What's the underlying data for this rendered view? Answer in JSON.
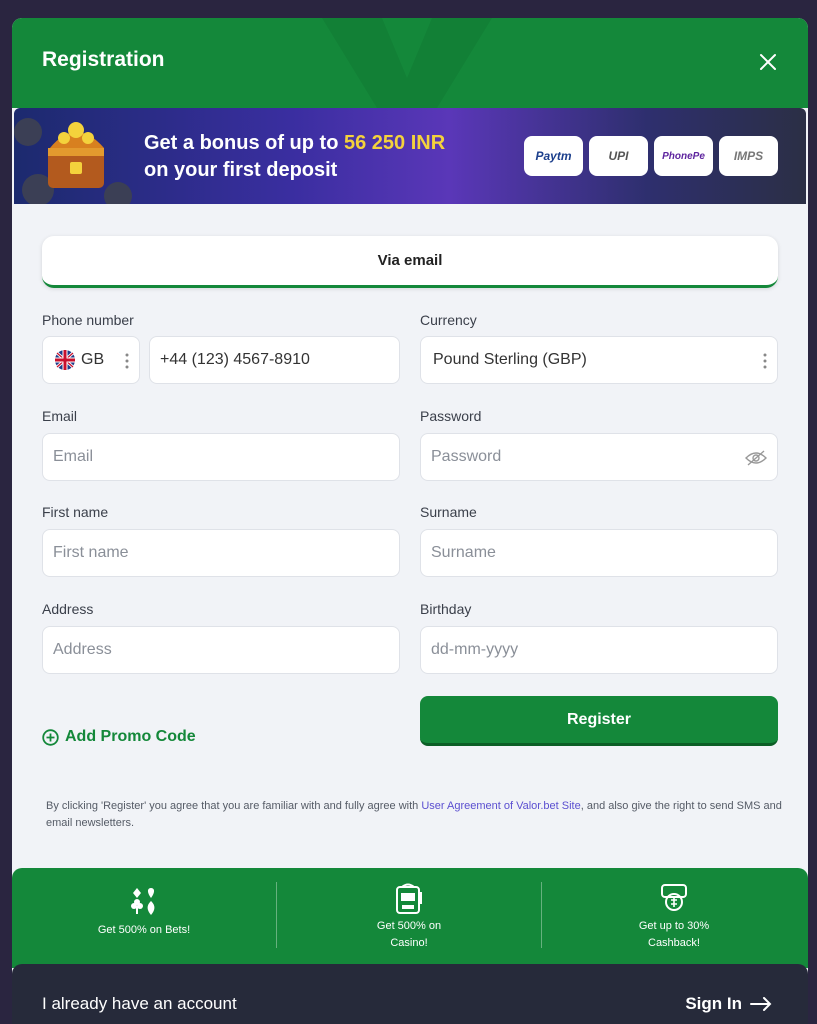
{
  "header": {
    "title": "Registration"
  },
  "banner": {
    "line1_prefix": "Get a bonus of up to ",
    "amount": "56 250 INR",
    "line2": "on your first deposit",
    "payments": [
      "Paytm",
      "UPI",
      "PhonePe",
      "IMPS"
    ]
  },
  "tabs": {
    "email": "Via email"
  },
  "form": {
    "phone": {
      "label": "Phone number",
      "country": "GB",
      "value": "+44 (123) 4567-8910"
    },
    "currency": {
      "label": "Currency",
      "value": "Pound Sterling (GBP)"
    },
    "email": {
      "label": "Email",
      "placeholder": "Email"
    },
    "password": {
      "label": "Password",
      "placeholder": "Password"
    },
    "first_name": {
      "label": "First name",
      "placeholder": "First name"
    },
    "surname": {
      "label": "Surname",
      "placeholder": "Surname"
    },
    "address": {
      "label": "Address",
      "placeholder": "Address"
    },
    "birthday": {
      "label": "Birthday",
      "placeholder": "dd-mm-yyyy"
    }
  },
  "actions": {
    "promo": "Add Promo Code",
    "register": "Register"
  },
  "terms": {
    "before": "By clicking 'Register' you agree that you are familiar with and fully agree with ",
    "link": "User Agreement of Valor.bet Site",
    "after": ", and also give the right to send SMS and email newsletters."
  },
  "perks": [
    {
      "text": "Get 500% on Bets!",
      "icon": "cards-icon"
    },
    {
      "text": "Get 500% on Casino!",
      "icon": "slot-machine-icon"
    },
    {
      "text": "Get up to 30% Cashback!",
      "icon": "cashback-icon"
    }
  ],
  "footer": {
    "text": "I already have an account",
    "signin": "Sign In"
  },
  "colors": {
    "primary": "#14883a",
    "accent": "#f4d23c",
    "link": "#5b4fd0"
  }
}
